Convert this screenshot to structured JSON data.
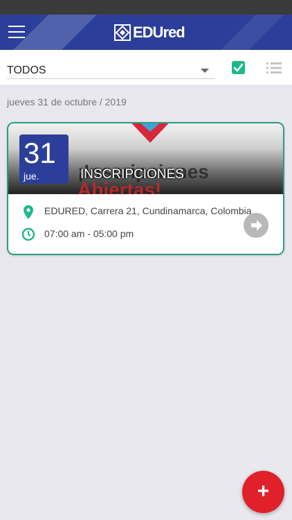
{
  "header": {
    "logo_text": "EDUred",
    "brand_color": "#2b3f9a",
    "menu_icon": "hamburger-menu-icon"
  },
  "filter": {
    "selected": "TODOS",
    "check_icon": "checkbox-checked-icon",
    "list_icon": "list-view-icon"
  },
  "date_group": {
    "label": "jueves 31 de octubre / 2019"
  },
  "event": {
    "day": "31",
    "weekday": "jue.",
    "title": "INSCRIPCIONES",
    "banner_text_line1": "¡Inscripciones",
    "banner_text_line2": "Abiertas!",
    "location": "EDURED, Carrera 21, Cundinamarca, Colombia",
    "time": "07:00 am - 05:00 pm",
    "location_icon": "map-pin-icon",
    "time_icon": "clock-icon",
    "open_icon": "arrow-right-circle-icon",
    "accent_color": "#2a9e7d"
  },
  "fab": {
    "label": "+",
    "color": "#e0202a"
  }
}
